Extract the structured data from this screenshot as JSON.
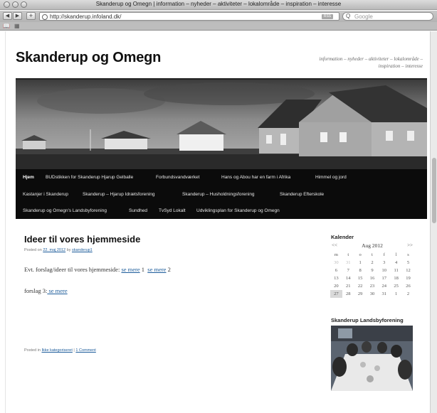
{
  "window": {
    "title": "Skanderup og Omegn | information – nyheder – aktiviteter – lokalområde – inspiration – interesse"
  },
  "toolbar": {
    "back": "◀",
    "forward": "▶",
    "add": "+",
    "url": "http://skanderup.infoland.dk/",
    "rss_label": "RSS",
    "reload": "¢",
    "search_placeholder": "Google"
  },
  "site": {
    "title": "Skanderup og Omegn",
    "description": "information – nyheder – aktiviteter – lokalområde – inspiration – interesse"
  },
  "menu": {
    "rows": [
      [
        "Hjem",
        "BUDstikken for Skanderup Hjarup Gelballe",
        "Forbundsvandværket",
        "Hans og Abou har en farm i Afrika",
        "Himmel og jord"
      ],
      [
        "Kastanjer i Skanderup",
        "Skanderup – Hjarup Idrætsforening",
        "Skanderup – Husholdningsforening",
        "Skanderup Efterskole"
      ],
      [
        "Skanderup og Omegn's Landsbyforening",
        "Sundhed",
        "TvSyd Lokalt",
        "Udviklingsplan for Skanderup og Omegn"
      ]
    ]
  },
  "post": {
    "title": "Ideer til vores hjemmeside",
    "meta_prefix": "Posted on",
    "date": "22. maj 2012",
    "meta_by": "by",
    "author": "skanderup1",
    "line1_text": "Evt. forslag/ideer til vores hjemmeside:",
    "link1": "se mere",
    "link1_suffix": "1",
    "link2": "se mere",
    "link2_suffix": "2",
    "line2_text": "forslag 3:",
    "link3": " se mere",
    "footer_prefix": "Posted in",
    "category": "Ikke kategoriseret",
    "footer_sep": "|",
    "comments": "1 Comment"
  },
  "calendar": {
    "title": "Kalender",
    "prev": "<<",
    "next": ">>",
    "month": "Aug 2012",
    "weekdays": [
      "m",
      "t",
      "o",
      "t",
      "f",
      "l",
      "s"
    ],
    "weeks": [
      [
        "30",
        "31",
        "1",
        "2",
        "3",
        "4",
        "5"
      ],
      [
        "6",
        "7",
        "8",
        "9",
        "10",
        "11",
        "12"
      ],
      [
        "13",
        "14",
        "15",
        "16",
        "17",
        "18",
        "19"
      ],
      [
        "20",
        "21",
        "22",
        "23",
        "24",
        "25",
        "26"
      ],
      [
        "27",
        "28",
        "29",
        "30",
        "31",
        "1",
        "2"
      ]
    ],
    "today": "27"
  },
  "sidebar": {
    "photo_widget_title": "Skanderup Landsbyforening"
  },
  "colors": {
    "menu_bg": "#0b0b0b",
    "link": "#1b5b9a",
    "text": "#111111"
  }
}
